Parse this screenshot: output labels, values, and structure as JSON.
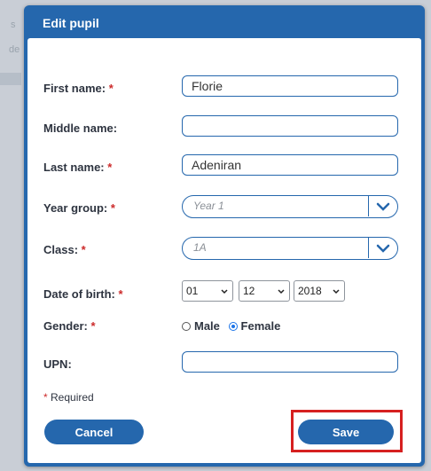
{
  "dialog": {
    "title": "Edit pupil",
    "required_marker": "*",
    "required_note_text": "Required"
  },
  "form": {
    "first_name": {
      "label": "First name:",
      "value": "Florie"
    },
    "middle_name": {
      "label": "Middle name:",
      "value": ""
    },
    "last_name": {
      "label": "Last name:",
      "value": "Adeniran"
    },
    "year_group": {
      "label": "Year group:",
      "value": "Year 1"
    },
    "class": {
      "label": "Class:",
      "value": "1A"
    },
    "date_of_birth": {
      "label": "Date of birth:",
      "day": "01",
      "month": "12",
      "year": "2018"
    },
    "gender": {
      "label": "Gender:",
      "options": [
        "Male",
        "Female"
      ],
      "selected": "Female"
    },
    "upn": {
      "label": "UPN:",
      "value": ""
    }
  },
  "buttons": {
    "cancel": "Cancel",
    "save": "Save"
  },
  "background": {
    "frag_top": "s",
    "frag_mid": "de"
  },
  "colors": {
    "dialog_blue": "#2567ad",
    "required_red": "#cc2a2a",
    "highlight_red": "#d62020"
  },
  "icons": {
    "dropdown": "chevron-down-icon",
    "caret": "caret-down-icon"
  }
}
